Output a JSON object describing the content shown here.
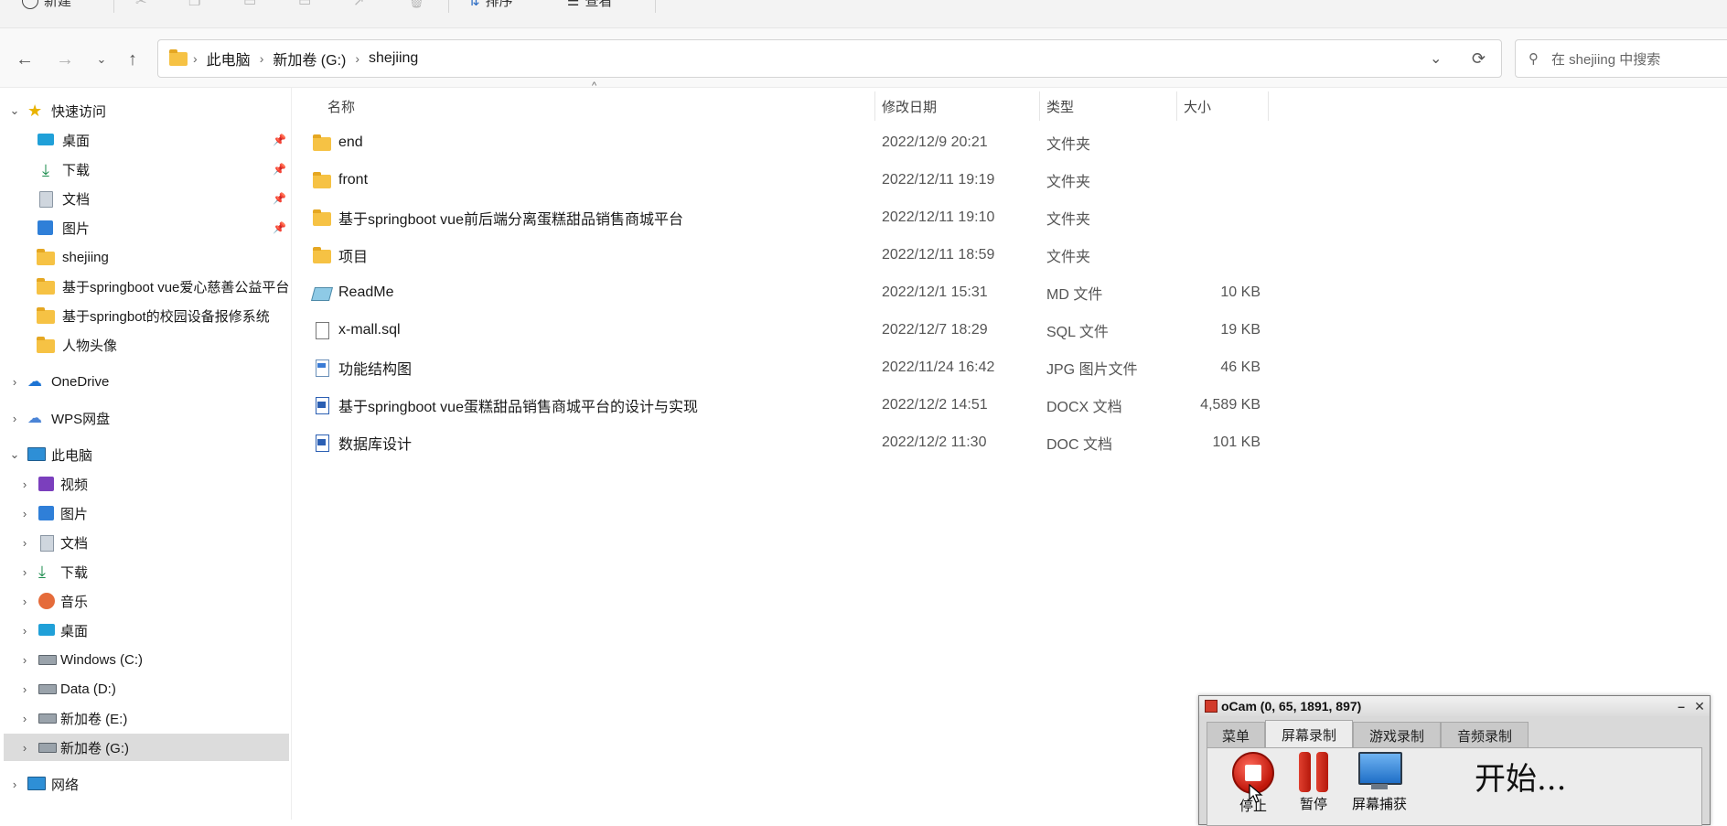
{
  "toolbar": {
    "new_label": "新建",
    "sort_label": "排序",
    "view_label": "查看"
  },
  "nav": {
    "breadcrumbs": [
      "此电脑",
      "新加卷 (G:)",
      "shejiing"
    ],
    "search_placeholder": "在 shejiing 中搜索"
  },
  "sidebar": {
    "quick_access": {
      "label": "快速访问",
      "items": [
        {
          "label": "桌面",
          "icon": "desktop-icon",
          "pinned": true
        },
        {
          "label": "下载",
          "icon": "download-icon",
          "pinned": true
        },
        {
          "label": "文档",
          "icon": "documents-icon",
          "pinned": true
        },
        {
          "label": "图片",
          "icon": "pictures-icon",
          "pinned": true
        },
        {
          "label": "shejiing",
          "icon": "folder-icon"
        },
        {
          "label": "基于springboot vue爱心慈善公益平台",
          "icon": "folder-icon"
        },
        {
          "label": "基于springbot的校园设备报修系统",
          "icon": "folder-icon"
        },
        {
          "label": "人物头像",
          "icon": "folder-icon"
        }
      ]
    },
    "onedrive": "OneDrive",
    "wps": "WPS网盘",
    "this_pc": {
      "label": "此电脑",
      "items": [
        {
          "label": "视频",
          "icon": "videos-icon"
        },
        {
          "label": "图片",
          "icon": "pictures-icon"
        },
        {
          "label": "文档",
          "icon": "documents-icon"
        },
        {
          "label": "下载",
          "icon": "download-icon"
        },
        {
          "label": "音乐",
          "icon": "music-icon"
        },
        {
          "label": "桌面",
          "icon": "desktop-icon"
        },
        {
          "label": "Windows (C:)",
          "icon": "drive-icon"
        },
        {
          "label": "Data (D:)",
          "icon": "drive-icon"
        },
        {
          "label": "新加卷 (E:)",
          "icon": "drive-icon"
        },
        {
          "label": "新加卷 (G:)",
          "icon": "drive-icon",
          "selected": true
        }
      ]
    },
    "network": "网络"
  },
  "columns": {
    "name": "名称",
    "date": "修改日期",
    "type": "类型",
    "size": "大小"
  },
  "files": [
    {
      "name": "end",
      "date": "2022/12/9 20:21",
      "type": "文件夹",
      "size": "",
      "icon": "folder-icon"
    },
    {
      "name": "front",
      "date": "2022/12/11 19:19",
      "type": "文件夹",
      "size": "",
      "icon": "folder-icon"
    },
    {
      "name": "基于springboot vue前后端分离蛋糕甜品销售商城平台",
      "date": "2022/12/11 19:10",
      "type": "文件夹",
      "size": "",
      "icon": "folder-icon"
    },
    {
      "name": "项目",
      "date": "2022/12/11 18:59",
      "type": "文件夹",
      "size": "",
      "icon": "folder-icon"
    },
    {
      "name": "ReadMe",
      "date": "2022/12/1 15:31",
      "type": "MD 文件",
      "size": "10 KB",
      "icon": "markdown-file-icon"
    },
    {
      "name": "x-mall.sql",
      "date": "2022/12/7 18:29",
      "type": "SQL 文件",
      "size": "19 KB",
      "icon": "blank-file-icon"
    },
    {
      "name": "功能结构图",
      "date": "2022/11/24 16:42",
      "type": "JPG 图片文件",
      "size": "46 KB",
      "icon": "image-file-icon"
    },
    {
      "name": "基于springboot vue蛋糕甜品销售商城平台的设计与实现",
      "date": "2022/12/2 14:51",
      "type": "DOCX 文档",
      "size": "4,589 KB",
      "icon": "word-file-icon"
    },
    {
      "name": "数据库设计",
      "date": "2022/12/2 11:30",
      "type": "DOC 文档",
      "size": "101 KB",
      "icon": "word-file-icon"
    }
  ],
  "ocam": {
    "title": "oCam (0, 65, 1891, 897)",
    "tabs": [
      "菜单",
      "屏幕录制",
      "游戏录制",
      "音频录制"
    ],
    "active_tab": "屏幕录制",
    "buttons": {
      "stop": "停止",
      "pause": "暂停",
      "capture": "屏幕捕获"
    },
    "status": "开始..."
  }
}
